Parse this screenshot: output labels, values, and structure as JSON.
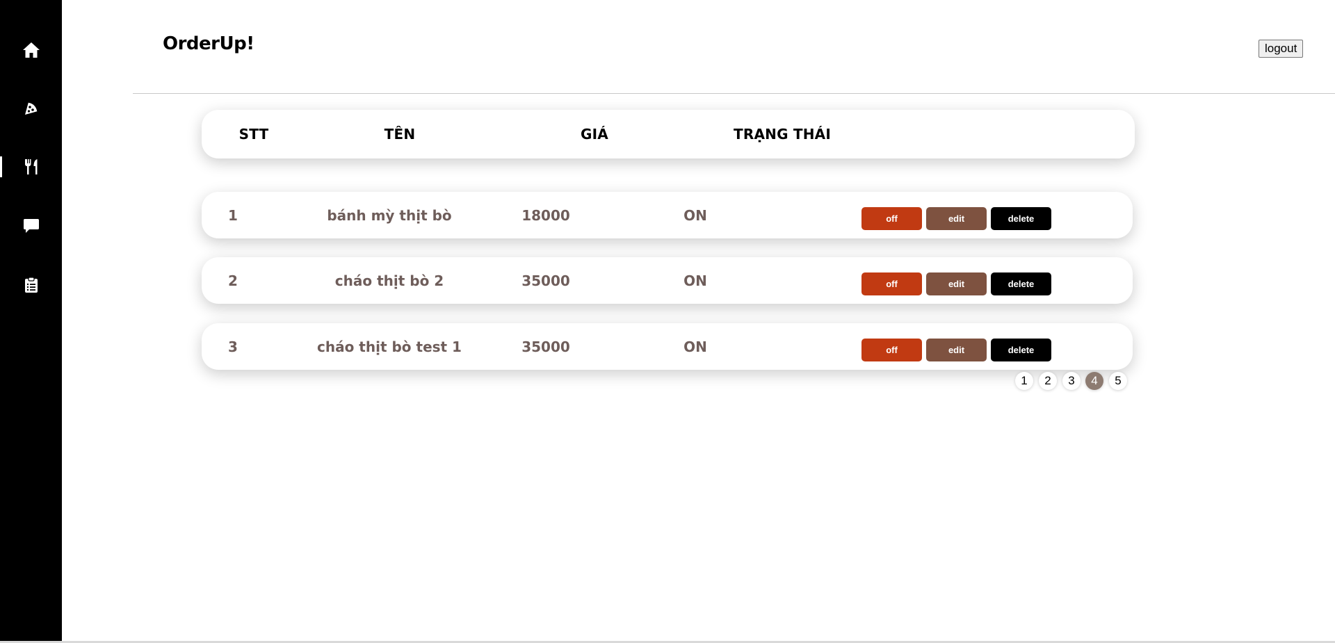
{
  "app": {
    "logo": "OrderUp!",
    "logout_label": "logout"
  },
  "sidebar": {
    "items": [
      {
        "icon": "home-icon",
        "active": false
      },
      {
        "icon": "pizza-icon",
        "active": false
      },
      {
        "icon": "utensils-icon",
        "active": true
      },
      {
        "icon": "chat-icon",
        "active": false
      },
      {
        "icon": "clipboard-icon",
        "active": false
      }
    ]
  },
  "table": {
    "headers": {
      "stt": "STT",
      "name": "TÊN",
      "price": "GIÁ",
      "status": "TRẠNG THÁI"
    },
    "rows": [
      {
        "stt": "1",
        "name": "bánh mỳ thịt bò",
        "price": "18000",
        "status": "ON",
        "off_label": "off",
        "edit_label": "edit",
        "delete_label": "delete"
      },
      {
        "stt": "2",
        "name": "cháo thịt bò 2",
        "price": "35000",
        "status": "ON",
        "off_label": "off",
        "edit_label": "edit",
        "delete_label": "delete"
      },
      {
        "stt": "3",
        "name": "cháo thịt bò test 1",
        "price": "35000",
        "status": "ON",
        "off_label": "off",
        "edit_label": "edit",
        "delete_label": "delete"
      }
    ]
  },
  "pagination": {
    "pages": [
      "1",
      "2",
      "3",
      "4",
      "5"
    ],
    "current": "4"
  },
  "colors": {
    "sidebar_bg": "#000000",
    "row_text": "#6e5d5a",
    "off_button": "#c13a12",
    "edit_button": "#7e5240",
    "delete_button": "#000000",
    "active_page": "#8d7b71"
  }
}
